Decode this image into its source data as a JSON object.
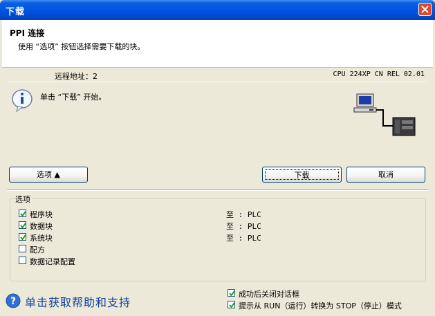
{
  "window": {
    "title": "下载"
  },
  "header": {
    "title": "PPI 连接",
    "subtitle": "使用 “选项” 按钮选择需要下载的块。"
  },
  "connection": {
    "remote_address": "远程地址：2",
    "cpu_info": "CPU 224XP CN REL 02.01"
  },
  "status": {
    "message": "单击 “下载” 开始。"
  },
  "buttons": {
    "options": "选项 ▲",
    "download": "下载",
    "cancel": "取消"
  },
  "options_group": {
    "label": "选项",
    "items": [
      {
        "label": "程序块",
        "checked": true,
        "target": "至 : PLC"
      },
      {
        "label": "数据块",
        "checked": true,
        "target": "至 : PLC"
      },
      {
        "label": "系统块",
        "checked": true,
        "target": "至 : PLC"
      },
      {
        "label": "配方",
        "checked": false,
        "target": ""
      },
      {
        "label": "数据记录配置",
        "checked": false,
        "target": ""
      }
    ]
  },
  "post_options": [
    {
      "label": "成功后关闭对话框",
      "checked": true
    },
    {
      "label": "提示从 RUN（运行）转换为 STOP（停止）模式",
      "checked": true
    }
  ],
  "help": {
    "text": "单击获取帮助和支持"
  },
  "colors": {
    "titlebar": "#0055e5",
    "dialog_bg": "#ece9d8",
    "close_button": "#e0472b",
    "help_link": "#1040a0"
  }
}
